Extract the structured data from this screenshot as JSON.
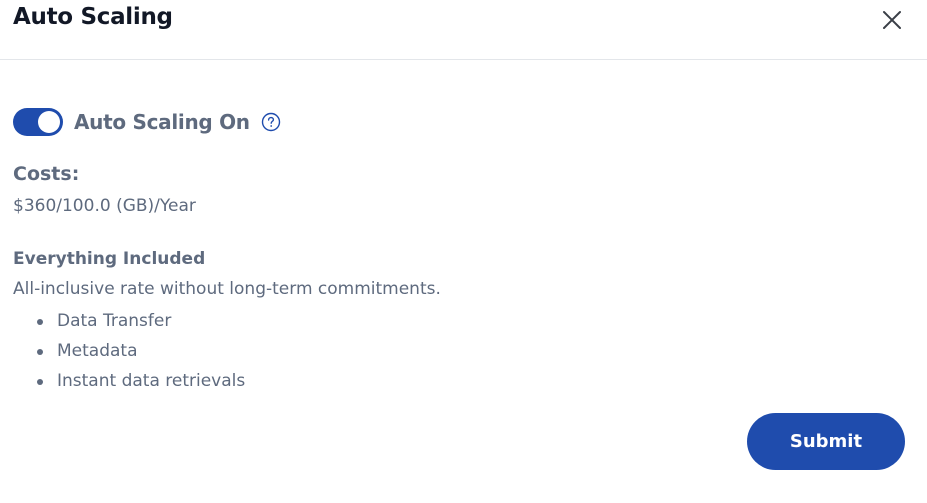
{
  "dialog": {
    "title": "Auto Scaling",
    "close_icon": "close-icon"
  },
  "auto_scaling": {
    "label": "Auto Scaling On",
    "enabled": true,
    "help_icon": "question-circle-icon"
  },
  "costs": {
    "label": "Costs:",
    "value": "$360/100.0 (GB)/Year"
  },
  "plan": {
    "name": "Everything Included",
    "description": "All-inclusive rate without long-term commitments.",
    "features": [
      "Data Transfer",
      "Metadata",
      "Instant data retrievals"
    ]
  },
  "actions": {
    "submit_label": "Submit"
  },
  "colors": {
    "accent": "#1f4cad",
    "title_text": "#121826",
    "body_text": "#5e6a7e",
    "divider": "#e3e6ea"
  }
}
